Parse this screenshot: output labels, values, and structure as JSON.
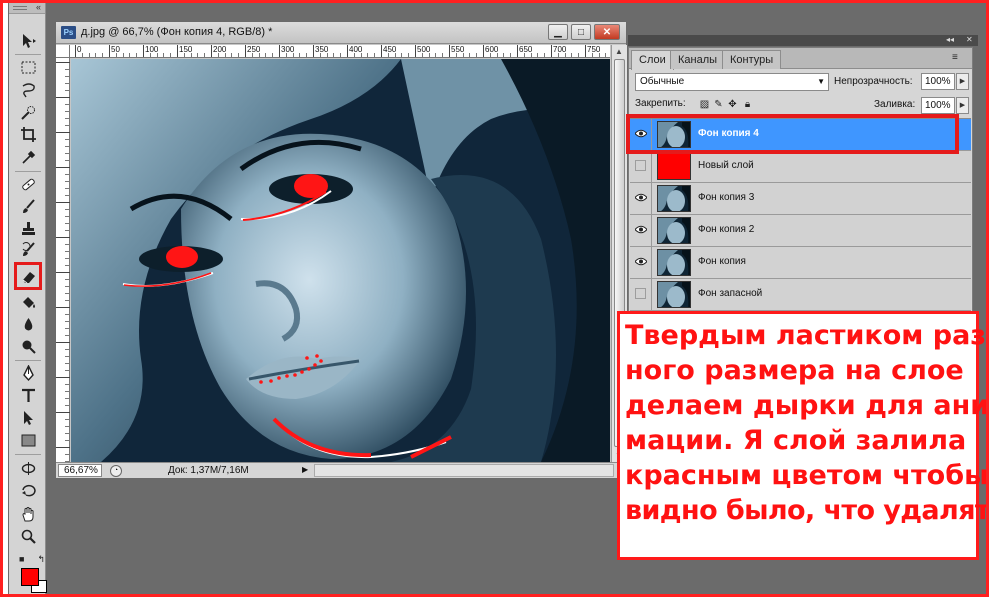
{
  "document": {
    "title": "д.jpg @ 66,7% (Фон копия 4, RGB/8) *",
    "app_badge": "Ps",
    "ruler_labels": [
      "0",
      "50",
      "100",
      "150",
      "200",
      "250",
      "300",
      "350",
      "400",
      "450",
      "500",
      "550",
      "600",
      "650",
      "700",
      "750"
    ],
    "zoom": "66,67%",
    "doc_size": "Док: 1,37M/7,16M"
  },
  "layers_panel": {
    "tabs": [
      "Слои",
      "Каналы",
      "Контуры"
    ],
    "blend_mode": "Обычные",
    "opacity_label": "Непрозрачность:",
    "opacity_value": "100%",
    "lock_label": "Закрепить:",
    "fill_label": "Заливка:",
    "fill_value": "100%",
    "layers": [
      {
        "name": "Фон копия 4",
        "visible": true,
        "selected": true,
        "thumb": "photo"
      },
      {
        "name": "Новый слой",
        "visible": false,
        "selected": false,
        "thumb": "red"
      },
      {
        "name": "Фон копия 3",
        "visible": true,
        "selected": false,
        "thumb": "photo"
      },
      {
        "name": "Фон копия 2",
        "visible": true,
        "selected": false,
        "thumb": "photo"
      },
      {
        "name": "Фон копия",
        "visible": true,
        "selected": false,
        "thumb": "photo"
      },
      {
        "name": "Фон запасной",
        "visible": false,
        "selected": false,
        "thumb": "photo"
      }
    ]
  },
  "tools": {
    "items": [
      "move-icon",
      "marquee-icon",
      "lasso-icon",
      "quick-select-icon",
      "crop-icon",
      "eyedropper-icon",
      "healing-icon",
      "brush-icon",
      "stamp-icon",
      "history-brush-icon",
      "eraser-icon",
      "paint-bucket-icon",
      "blur-icon",
      "dodge-icon",
      "pen-icon",
      "text-icon",
      "path-select-icon",
      "rectangle-icon",
      "rotate-3d-icon",
      "orbit-3d-icon",
      "hand-icon",
      "zoom-icon"
    ],
    "active": "eraser-icon",
    "foreground_color": "#ff0000",
    "background_color": "#ffffff"
  },
  "annotation": {
    "lines": [
      "Твердым ластиком раз-",
      "ного размера на слое",
      "делаем дырки для ани-",
      "мации. Я слой залила",
      "красным цветом чтобы",
      "видно было, что удалять."
    ],
    "color": "#ff1212"
  },
  "colors": {
    "selection": "#3f96ff",
    "highlight_frame": "#e51b1b"
  }
}
